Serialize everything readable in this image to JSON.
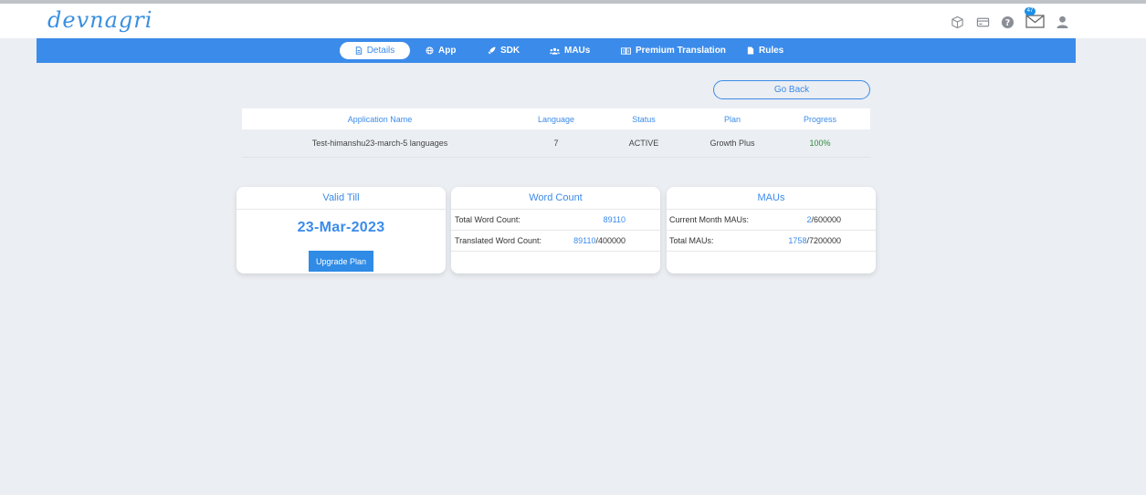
{
  "header": {
    "logo": "devnagri",
    "mail_count": "47",
    "icons": [
      "cube-icon",
      "card-icon",
      "help-icon",
      "mail-icon",
      "user-icon"
    ]
  },
  "nav": {
    "tabs": [
      {
        "label": "Details",
        "icon": "document-icon",
        "active": true
      },
      {
        "label": "App",
        "icon": "globe-icon"
      },
      {
        "label": "SDK",
        "icon": "rocket-icon"
      },
      {
        "label": "MAUs",
        "icon": "users-icon"
      },
      {
        "label": "Premium Translation",
        "icon": "translate-icon"
      },
      {
        "label": "Rules",
        "icon": "file-icon"
      }
    ]
  },
  "go_back_label": "Go Back",
  "table": {
    "headers": [
      "Application Name",
      "Language",
      "Status",
      "Plan",
      "Progress"
    ],
    "rows": [
      [
        "Test-himanshu23-march-5 languages",
        "7",
        "ACTIVE",
        "Growth Plus",
        "100%"
      ]
    ]
  },
  "cards": {
    "valid": {
      "title": "Valid Till",
      "date": "23-Mar-2023",
      "button": "Upgrade Plan"
    },
    "words": {
      "title": "Word Count",
      "rows": [
        {
          "label": "Total Word Count:",
          "value": "89110",
          "total": ""
        },
        {
          "label": "Translated Word Count:",
          "value": "89110",
          "total": "/400000"
        }
      ]
    },
    "maus": {
      "title": "MAUs",
      "rows": [
        {
          "label": "Current Month MAUs:",
          "value": "2",
          "total": "/600000"
        },
        {
          "label": "Total MAUs:",
          "value": "1758",
          "total": "/7200000"
        }
      ]
    }
  },
  "colors": {
    "accent": "#3b8bea",
    "progress": "#2f8a3c",
    "background": "#ebeef2"
  }
}
